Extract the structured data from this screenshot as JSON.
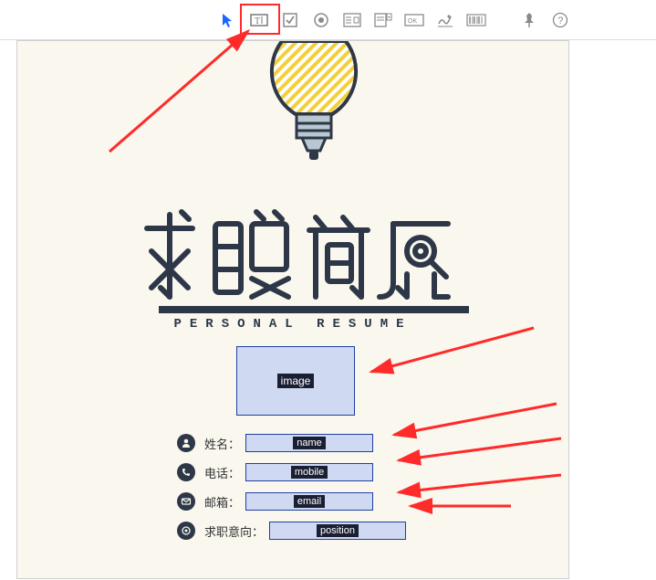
{
  "toolbar": {
    "icons": {
      "pointer": "pointer-icon",
      "text": "text-field-icon",
      "checkbox": "checkbox-icon",
      "radio": "radio-icon",
      "form": "form-icon",
      "dropdown": "dropdown-icon",
      "okbox": "ok-button-icon",
      "signature": "signature-icon",
      "barcode": "barcode-icon",
      "pin": "pin-icon",
      "help": "help-icon"
    }
  },
  "document": {
    "title_cn": "求职简历",
    "subtitle_en": "PERSONAL  RESUME",
    "image_placeholder_label": "image",
    "fields": {
      "name": {
        "label": "姓名：",
        "placeholder": "name"
      },
      "mobile": {
        "label": "电话：",
        "placeholder": "mobile"
      },
      "email": {
        "label": "邮箱：",
        "placeholder": "email"
      },
      "position": {
        "label": "求职意向：",
        "placeholder": "position"
      }
    }
  }
}
